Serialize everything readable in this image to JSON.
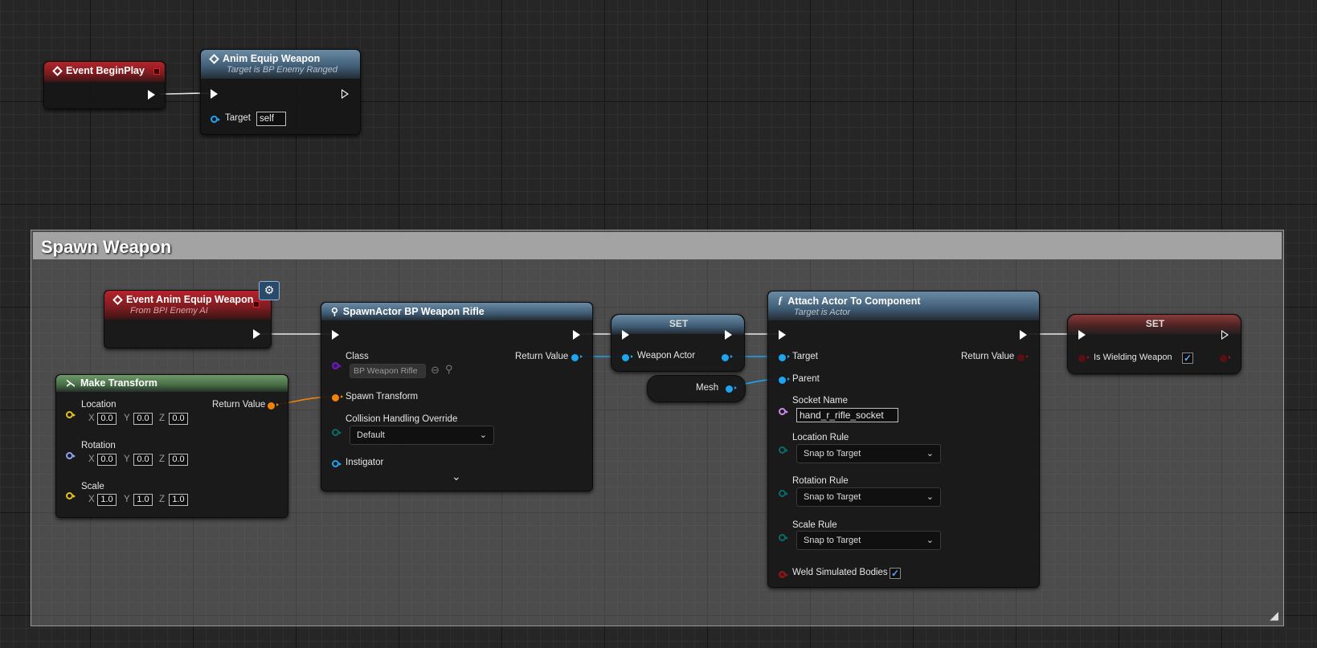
{
  "colors": {
    "exec": "#ffffff",
    "object_pin": "#1ea4f0",
    "struct_pin": "#f0820a",
    "vector_pin": "#e6c41e",
    "rotator_pin": "#8ca5ee",
    "class_pin": "#6a1fb5",
    "name_pin": "#c98cf0",
    "byte_pin": "#0b6b6b",
    "bool_pin": "#8a1a1a",
    "event_header": "#b5232b",
    "function_header": "#4a6c86",
    "pure_header": "#476c44"
  },
  "event_beginplay": {
    "title": "Event BeginPlay",
    "icon": "event-diamond-icon"
  },
  "anim_equip_weapon": {
    "title": "Anim Equip Weapon",
    "subtitle": "Target is BP Enemy Ranged",
    "target_label": "Target",
    "target_value": "self",
    "icon": "message-diamond-icon"
  },
  "comment": {
    "title": "Spawn Weapon"
  },
  "event_anim_equip": {
    "title": "Event Anim Equip Weapon",
    "subtitle": "From BPI Enemy AI",
    "icon": "event-diamond-icon",
    "badge_icon": "interface-event-icon"
  },
  "make_transform": {
    "title": "Make Transform",
    "return_label": "Return Value",
    "location": {
      "label": "Location",
      "x": "0.0",
      "y": "0.0",
      "z": "0.0"
    },
    "rotation": {
      "label": "Rotation",
      "x": "0.0",
      "y": "0.0",
      "z": "0.0"
    },
    "scale": {
      "label": "Scale",
      "x": "1.0",
      "y": "1.0",
      "z": "1.0"
    },
    "axis_x": "X",
    "axis_y": "Y",
    "axis_z": "Z"
  },
  "spawn_actor": {
    "title": "SpawnActor BP Weapon Rifle",
    "class_label": "Class",
    "class_value": "BP Weapon Rifle",
    "return_label": "Return Value",
    "spawn_transform_label": "Spawn Transform",
    "collision_label": "Collision Handling Override",
    "collision_value": "Default",
    "instigator_label": "Instigator"
  },
  "set_weapon": {
    "title": "SET",
    "var_label": "Weapon Actor"
  },
  "mesh": {
    "label": "Mesh"
  },
  "attach": {
    "title": "Attach Actor To Component",
    "subtitle": "Target is Actor",
    "target_label": "Target",
    "return_label": "Return Value",
    "parent_label": "Parent",
    "socket_label": "Socket Name",
    "socket_value": "hand_r_rifle_socket",
    "location_rule_label": "Location Rule",
    "location_rule_value": "Snap to Target",
    "rotation_rule_label": "Rotation Rule",
    "rotation_rule_value": "Snap to Target",
    "scale_rule_label": "Scale Rule",
    "scale_rule_value": "Snap to Target",
    "weld_label": "Weld Simulated Bodies",
    "weld_checked": true
  },
  "set_wielding": {
    "title": "SET",
    "var_label": "Is Wielding Weapon",
    "checked": true
  }
}
